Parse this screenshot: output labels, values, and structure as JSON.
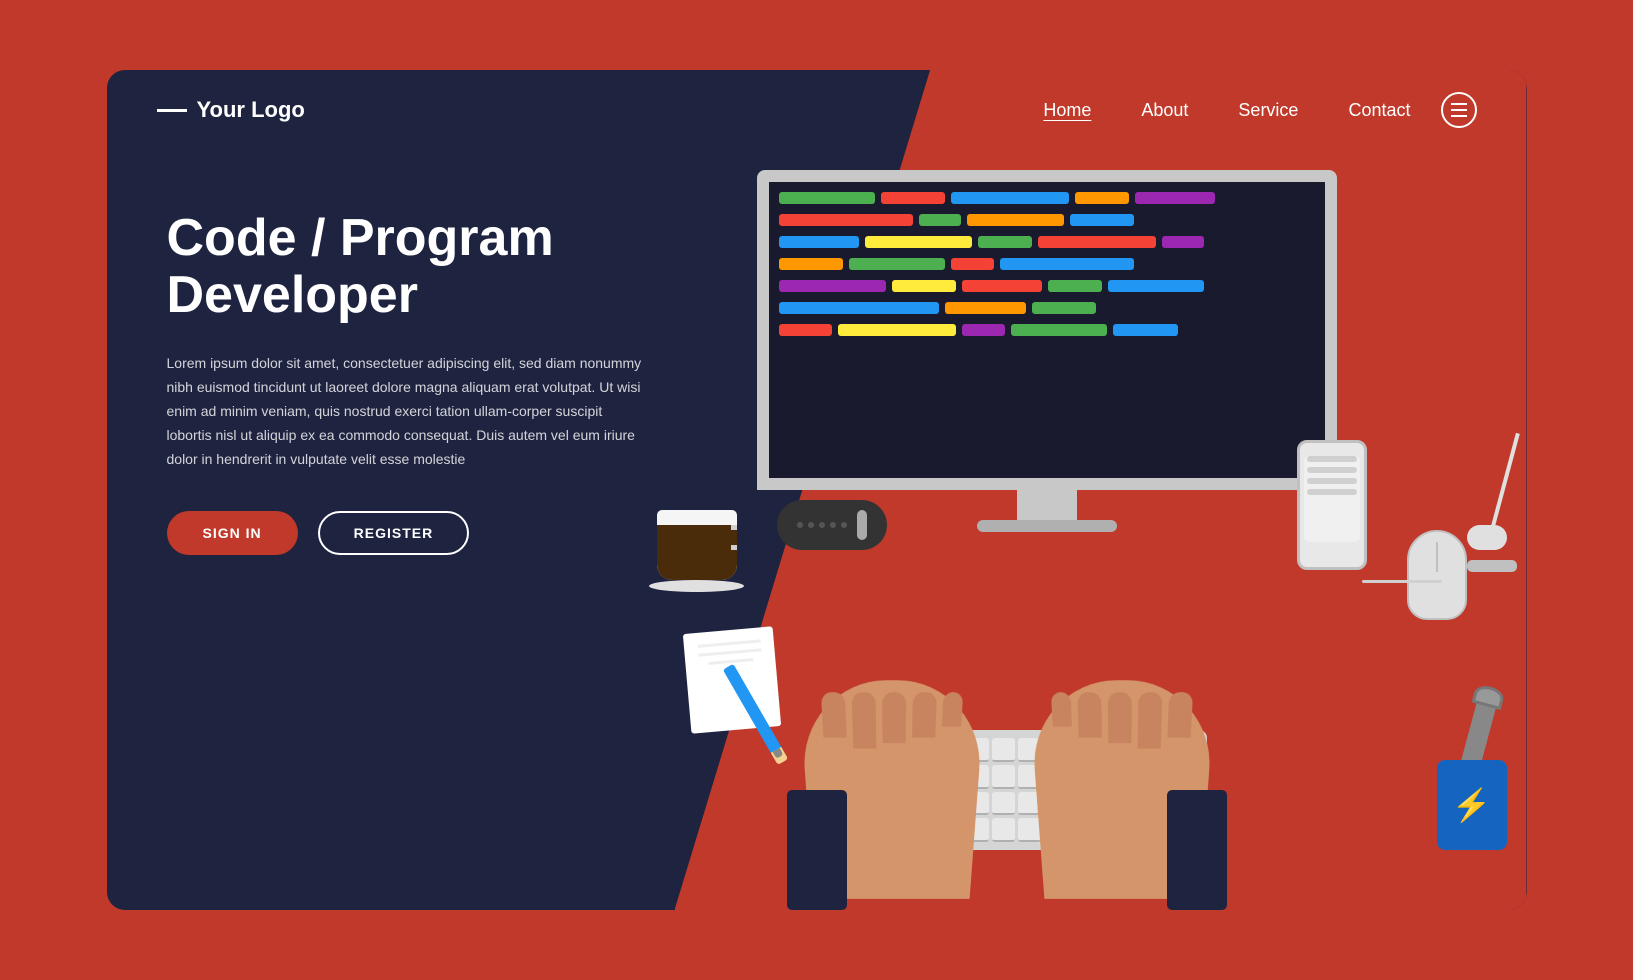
{
  "page": {
    "bg_color": "#c0392b"
  },
  "logo": {
    "text": "Your Logo"
  },
  "navbar": {
    "links": [
      {
        "label": "Home",
        "active": true
      },
      {
        "label": "About",
        "active": false
      },
      {
        "label": "Service",
        "active": false
      },
      {
        "label": "Contact",
        "active": false
      }
    ]
  },
  "hero": {
    "title": "Code / Program Developer",
    "description": "Lorem ipsum dolor sit amet, consectetuer adipiscing elit, sed diam nonummy nibh euismod tincidunt ut laoreet dolore magna aliquam erat volutpat. Ut wisi enim ad minim veniam, quis nostrud exerci tation ullam-corper suscipit lobortis nisl ut aliquip ex ea commodo consequat. Duis autem vel eum iriure dolor in hendrerit in vulputate velit esse molestie",
    "btn_signin": "SIGN IN",
    "btn_register": "REGISTER"
  },
  "code_lines": [
    [
      {
        "color": "#4CAF50",
        "width": "18%"
      },
      {
        "color": "#F44336",
        "width": "12%"
      },
      {
        "color": "#2196F3",
        "width": "22%"
      },
      {
        "color": "#FF9800",
        "width": "10%"
      },
      {
        "color": "#9C27B0",
        "width": "15%"
      }
    ],
    [
      {
        "color": "#F44336",
        "width": "25%"
      },
      {
        "color": "#4CAF50",
        "width": "8%"
      },
      {
        "color": "#FF9800",
        "width": "18%"
      },
      {
        "color": "#2196F3",
        "width": "12%"
      }
    ],
    [
      {
        "color": "#2196F3",
        "width": "15%"
      },
      {
        "color": "#FFEB3B",
        "width": "20%"
      },
      {
        "color": "#4CAF50",
        "width": "10%"
      },
      {
        "color": "#F44336",
        "width": "22%"
      },
      {
        "color": "#9C27B0",
        "width": "8%"
      }
    ],
    [
      {
        "color": "#FF9800",
        "width": "12%"
      },
      {
        "color": "#4CAF50",
        "width": "18%"
      },
      {
        "color": "#F44336",
        "width": "8%"
      },
      {
        "color": "#2196F3",
        "width": "25%"
      }
    ],
    [
      {
        "color": "#9C27B0",
        "width": "20%"
      },
      {
        "color": "#FFEB3B",
        "width": "12%"
      },
      {
        "color": "#F44336",
        "width": "15%"
      },
      {
        "color": "#4CAF50",
        "width": "10%"
      },
      {
        "color": "#2196F3",
        "width": "18%"
      }
    ],
    [
      {
        "color": "#2196F3",
        "width": "30%"
      },
      {
        "color": "#FF9800",
        "width": "15%"
      },
      {
        "color": "#4CAF50",
        "width": "12%"
      }
    ],
    [
      {
        "color": "#F44336",
        "width": "10%"
      },
      {
        "color": "#FFEB3B",
        "width": "22%"
      },
      {
        "color": "#9C27B0",
        "width": "8%"
      },
      {
        "color": "#4CAF50",
        "width": "18%"
      },
      {
        "color": "#2196F3",
        "width": "12%"
      }
    ]
  ]
}
